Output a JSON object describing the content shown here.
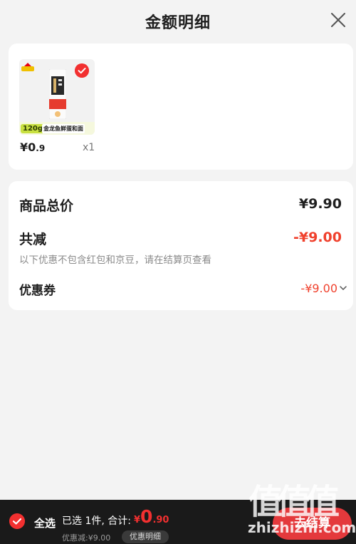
{
  "header": {
    "title": "金额明细"
  },
  "product": {
    "name_on_image": "金龙鱼鲜蛋和面",
    "weight_on_image": "120g",
    "price_symbol": "¥",
    "price_int": "0",
    "price_dec": ".9",
    "quantity": "x1",
    "selected": true
  },
  "summary": {
    "total_label": "商品总价",
    "total_value": "¥9.90",
    "reduce_label": "共减",
    "reduce_value": "-¥9.00",
    "note": "以下优惠不包含红包和京豆，请在结算页查看",
    "coupon_label": "优惠券",
    "coupon_value": "-¥9.00"
  },
  "bottom_bar": {
    "select_all_label": "全选",
    "selected_text": "已选 1件, 合计:",
    "total_symbol": "¥",
    "total_int": "0",
    "total_dec": ".90",
    "discount_text": "优惠减:¥9.00",
    "detail_button": "优惠明细",
    "checkout_button": "去结算"
  },
  "watermark": {
    "logo": "值值值",
    "site": "zhizhizhi.com"
  },
  "colors": {
    "accent": "#e4393c",
    "discount": "#f0412d",
    "background": "#f3f3f3",
    "bottom_bar": "#1a1a1a"
  },
  "icons": [
    "close-icon",
    "check-icon",
    "chevron-down-icon"
  ]
}
